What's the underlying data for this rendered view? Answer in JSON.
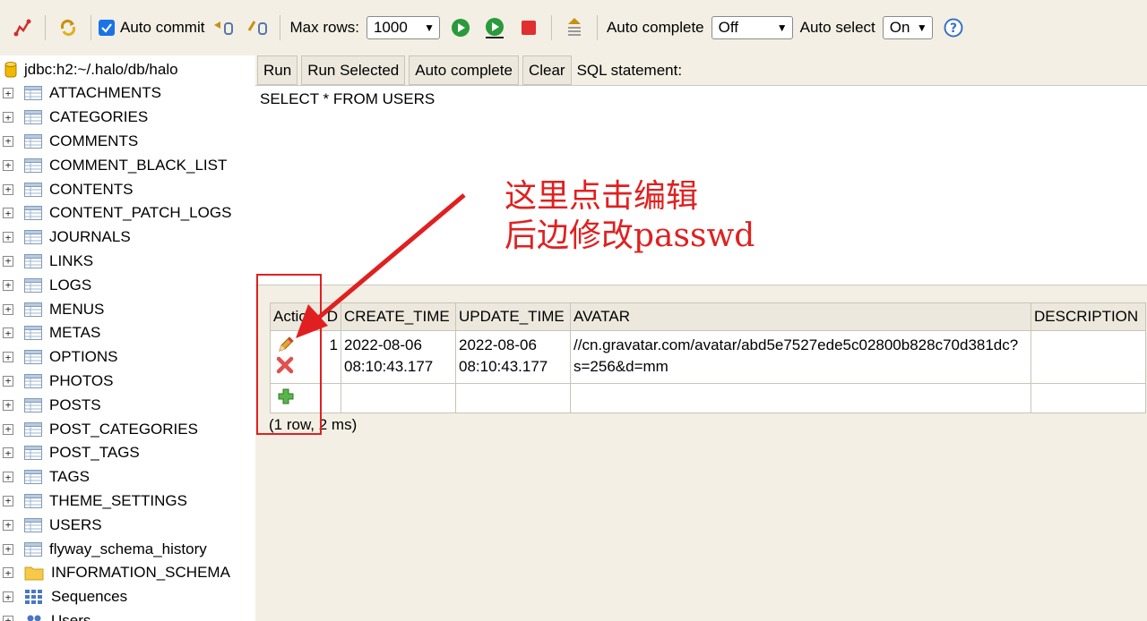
{
  "toolbar": {
    "auto_commit_label": "Auto commit",
    "auto_commit_checked": true,
    "max_rows_label": "Max rows:",
    "max_rows_value": "1000",
    "auto_complete_label": "Auto complete",
    "auto_complete_value": "Off",
    "auto_select_label": "Auto select",
    "auto_select_value": "On"
  },
  "tree": {
    "connection": "jdbc:h2:~/.halo/db/halo",
    "tables": [
      "ATTACHMENTS",
      "CATEGORIES",
      "COMMENTS",
      "COMMENT_BLACK_LIST",
      "CONTENTS",
      "CONTENT_PATCH_LOGS",
      "JOURNALS",
      "LINKS",
      "LOGS",
      "MENUS",
      "METAS",
      "OPTIONS",
      "PHOTOS",
      "POSTS",
      "POST_CATEGORIES",
      "POST_TAGS",
      "TAGS",
      "THEME_SETTINGS",
      "USERS",
      "flyway_schema_history"
    ],
    "schema": "INFORMATION_SCHEMA",
    "sequences": "Sequences",
    "users": "Users"
  },
  "query": {
    "run_label": "Run",
    "run_selected_label": "Run Selected",
    "auto_complete_label": "Auto complete",
    "clear_label": "Clear",
    "sql_statement_label": "SQL statement:",
    "sql": "SELECT * FROM USERS"
  },
  "results": {
    "headers": [
      "Actio",
      "D",
      "CREATE_TIME",
      "UPDATE_TIME",
      "AVATAR",
      "DESCRIPTION"
    ],
    "row": {
      "id": "1",
      "create_time_date": "2022-08-06",
      "create_time_time": "08:10:43.177",
      "update_time_date": "2022-08-06",
      "update_time_time": "08:10:43.177",
      "avatar_line1": "//cn.gravatar.com/avatar/abd5e7527ede5c02800b828c70d381dc?",
      "avatar_line2": "s=256&d=mm",
      "description": ""
    },
    "row_info": "(1 row, 2 ms)"
  },
  "annotation": {
    "line1": "这里点击编辑",
    "line2": "后边修改passwd",
    "color": "#e02020"
  }
}
